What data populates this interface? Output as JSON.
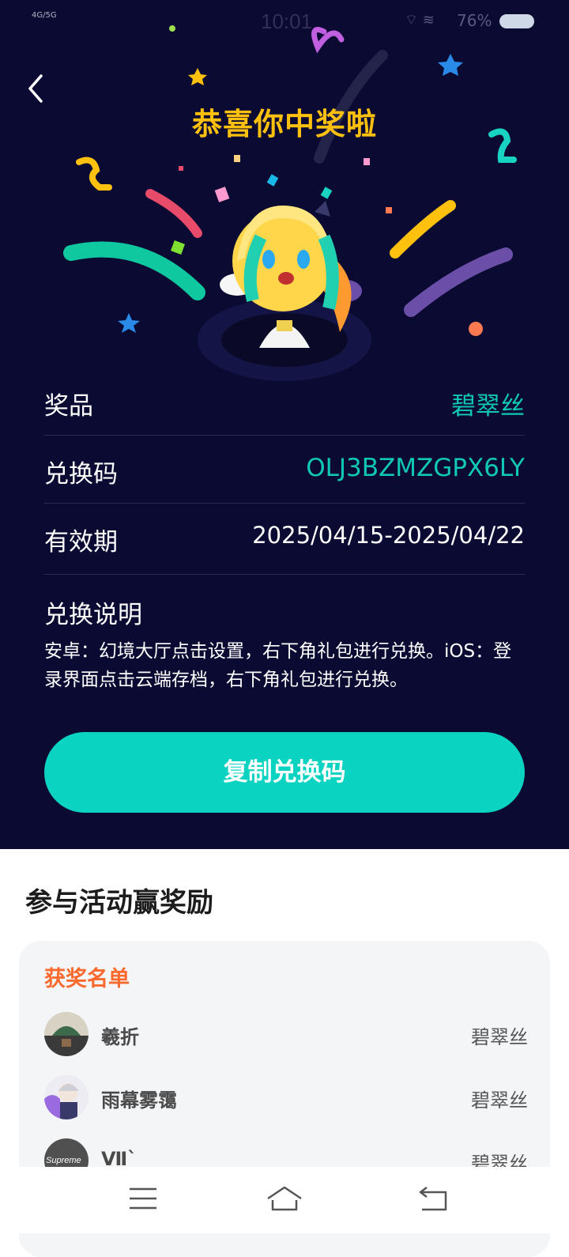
{
  "status_bar": {
    "signal_text": "4G/5G",
    "time": "10:01",
    "battery": "76%"
  },
  "header": {
    "title": "恭喜你中奖啦"
  },
  "prize": {
    "rows": [
      {
        "label": "奖品",
        "value": "碧翠丝"
      },
      {
        "label": "兑换码",
        "value": "OLJ3BZMZGPX6LY"
      },
      {
        "label": "有效期",
        "value": "2025/04/15-2025/04/22"
      }
    ],
    "instructions_title": "兑换说明",
    "instructions": "安卓：幻境大厅点击设置，右下角礼包进行兑换。iOS：登录界面点击云端存档，右下角礼包进行兑换。",
    "copy_button": "复制兑换码"
  },
  "activity": {
    "section_title": "参与活动赢奖励",
    "list_title": "获奖名单",
    "winners": [
      {
        "name": "羲折",
        "prize": "碧翠丝"
      },
      {
        "name": "雨幕雾霭",
        "prize": "碧翠丝"
      },
      {
        "name": "Ⅶ`",
        "prize": "碧翠丝"
      }
    ],
    "avatar3_text": "Supreme"
  },
  "colors": {
    "background": "#0b0a33",
    "accent": "#0bd3c1",
    "title": "#ffc10e",
    "list_title": "#fa6a2e"
  }
}
